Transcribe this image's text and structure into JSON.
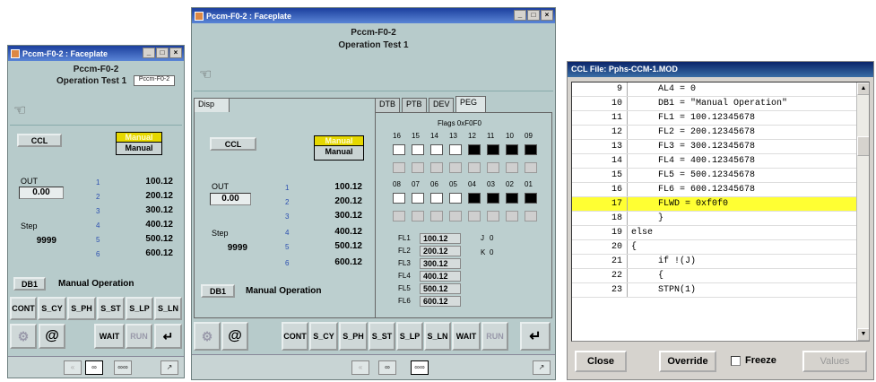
{
  "small": {
    "title": "Pccm-F0-2 : Faceplate",
    "name": "Pccm-F0-2",
    "op": "Operation Test 1",
    "tag": "Pccm-F0-2",
    "ccl": "CCL",
    "mode_hl": "Manual",
    "mode": "Manual",
    "out_label": "OUT",
    "out_value": "0.00",
    "step_label": "Step",
    "step_value": "9999",
    "idx": [
      "1",
      "2",
      "3",
      "4",
      "5",
      "6"
    ],
    "vals": [
      "100.12",
      "200.12",
      "300.12",
      "400.12",
      "500.12",
      "600.12"
    ],
    "db": "DB1",
    "db_text": "Manual Operation",
    "btns": [
      "CONT",
      "S_CY",
      "S_PH",
      "S_ST",
      "S_LP",
      "S_LN"
    ],
    "wait": "WAIT",
    "run": "RUN",
    "nav": [
      "«",
      "∞",
      "∞∞",
      "↗"
    ]
  },
  "big": {
    "title": "Pccm-F0-2 : Faceplate",
    "name": "Pccm-F0-2",
    "op": "Operation Test 1",
    "tab_disp": "Disp",
    "tabs": [
      "DTB",
      "PTB",
      "DEV",
      "PEG"
    ],
    "ccl": "CCL",
    "mode_hl": "Manual",
    "mode": "Manual",
    "out_label": "OUT",
    "out_value": "0.00",
    "step_label": "Step",
    "step_value": "9999",
    "idx": [
      "1",
      "2",
      "3",
      "4",
      "5",
      "6"
    ],
    "vals": [
      "100.12",
      "200.12",
      "300.12",
      "400.12",
      "500.12",
      "600.12"
    ],
    "db": "DB1",
    "db_text": "Manual Operation",
    "flags_title": "Flags 0xF0F0",
    "flag_hi_labels": [
      "16",
      "15",
      "14",
      "13",
      "12",
      "11",
      "10",
      "09"
    ],
    "flag_lo_labels": [
      "08",
      "07",
      "06",
      "05",
      "04",
      "03",
      "02",
      "01"
    ],
    "fl_labels": [
      "FL1",
      "FL2",
      "FL3",
      "FL4",
      "FL5",
      "FL6"
    ],
    "fl_values": [
      "100.12",
      "200.12",
      "300.12",
      "400.12",
      "500.12",
      "600.12"
    ],
    "j_label": "J",
    "j_value": "0",
    "k_label": "K",
    "k_value": "0",
    "btns": [
      "CONT",
      "S_CY",
      "S_PH",
      "S_ST",
      "S_LP",
      "S_LN",
      "WAIT",
      "RUN"
    ],
    "nav": [
      "«",
      "∞",
      "∞∞",
      "↗"
    ]
  },
  "code": {
    "title": "CCL File: Pphs-CCM-1.MOD",
    "lines": [
      {
        "n": "9",
        "t": "     AL4 = 0"
      },
      {
        "n": "10",
        "t": "     DB1 = \"Manual Operation\""
      },
      {
        "n": "11",
        "t": "     FL1 = 100.12345678"
      },
      {
        "n": "12",
        "t": "     FL2 = 200.12345678"
      },
      {
        "n": "13",
        "t": "     FL3 = 300.12345678"
      },
      {
        "n": "14",
        "t": "     FL4 = 400.12345678"
      },
      {
        "n": "15",
        "t": "     FL5 = 500.12345678"
      },
      {
        "n": "16",
        "t": "     FL6 = 600.12345678"
      },
      {
        "n": "17",
        "t": "     FLWD = 0xf0f0"
      },
      {
        "n": "18",
        "t": "     }"
      },
      {
        "n": "19",
        "t": "else"
      },
      {
        "n": "20",
        "t": "{"
      },
      {
        "n": "21",
        "t": "     if !(J)"
      },
      {
        "n": "22",
        "t": "     {"
      },
      {
        "n": "23",
        "t": "     STPN(1)"
      }
    ],
    "highlight_index": 8,
    "close": "Close",
    "override": "Override",
    "freeze": "Freeze",
    "values": "Values"
  }
}
